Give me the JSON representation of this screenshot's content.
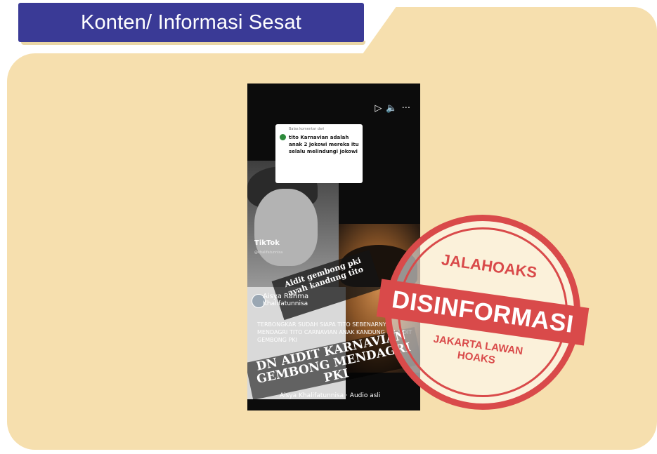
{
  "header": {
    "title": "Konten/ Informasi Sesat"
  },
  "screenshot": {
    "controls": [
      "▷",
      "🔈",
      "···"
    ],
    "comment": {
      "meta": "Balas komentar dari",
      "text": "tito Karnavian adalah anak 2 Jokowi mereka itu selalu melindungi jokowi"
    },
    "tiktok_label": "TikTok",
    "tiktok_handle": "@khalifatunnisa",
    "overlay_text": "Aidit gembong pki ayah kandung tito",
    "user_name": "Aisya Rahma",
    "user_sub": "Khalifatunnisa",
    "caption": "TERBONGKAR SUDAH SIAPA TITO SEBENARNYA MENDAGRI TITO CARNAVIAN ANAK KANDUNG DN AIDIT GEMBONG PKI",
    "big_text": "DN AIDIT KARNAVIAN GEMBONG MENDAGRI PKI",
    "audio": "Aisya Khalifatunnisa · Audio asli"
  },
  "stamp": {
    "top": "JALAHOAKS",
    "middle": "DISINFORMASI",
    "bottom_line1": "JAKARTA LAWAN",
    "bottom_line2": "HOAKS",
    "color": "#d94a4a"
  },
  "colors": {
    "banner": "#3a3a96",
    "folder": "#f6dfae"
  }
}
